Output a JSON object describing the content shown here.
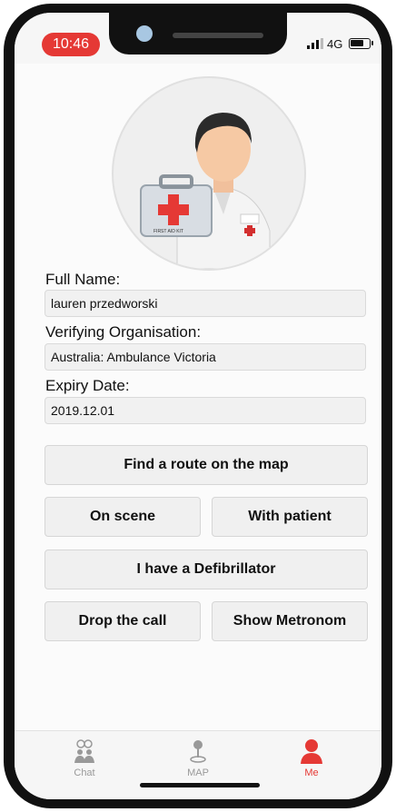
{
  "status": {
    "time": "10:46",
    "network": "4G",
    "battery_level": 0.8
  },
  "profile": {
    "full_name_label": "Full Name:",
    "full_name_value": "lauren przedworski",
    "org_label": "Verifying Organisation:",
    "org_value": "Australia: Ambulance Victoria",
    "expiry_label": "Expiry Date:",
    "expiry_value": "2019.12.01"
  },
  "actions": {
    "find_route": "Find a route on the map",
    "on_scene": "On scene",
    "with_patient": "With patient",
    "defibrillator": "I have a Defibrillator",
    "drop_call": "Drop the call",
    "show_metronome": "Show Metronom"
  },
  "tabs": [
    {
      "label": "Chat",
      "icon": "chat-people-icon"
    },
    {
      "label": "MAP",
      "icon": "map-pin-icon"
    },
    {
      "label": "Me",
      "icon": "person-icon",
      "active": true
    }
  ],
  "avatar": {
    "kit_label": "FIRST AID KIT"
  },
  "colors": {
    "accent": "#e53935"
  }
}
